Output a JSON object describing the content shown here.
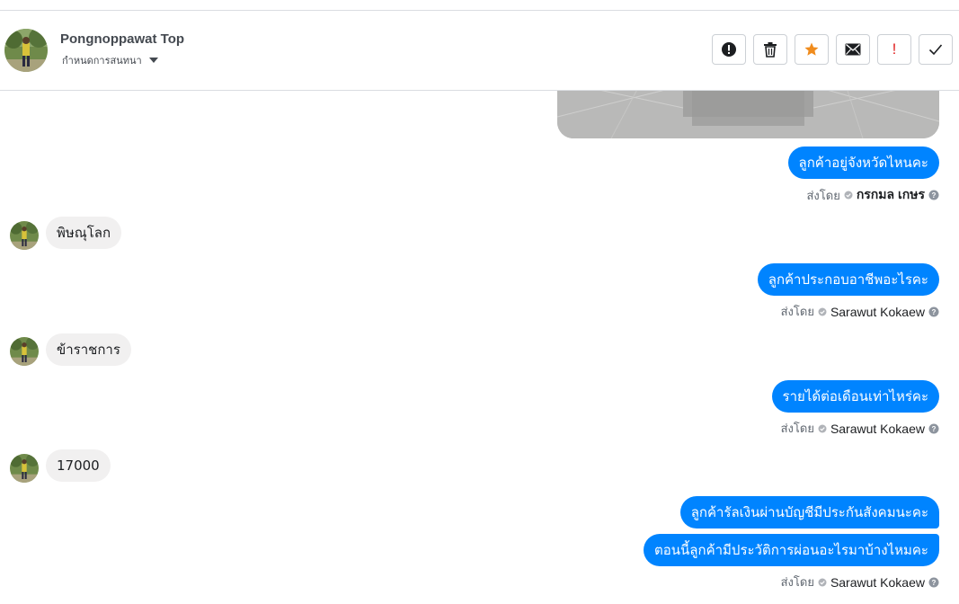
{
  "header": {
    "contact_name": "Pongnoppawat Top",
    "subtitle": "กำหนดการสนทนา",
    "actions": [
      {
        "name": "report-icon",
        "label": "!"
      },
      {
        "name": "trash-icon",
        "label": ""
      },
      {
        "name": "star-icon",
        "label": "",
        "color": "#f08c1d"
      },
      {
        "name": "envelope-icon",
        "label": ""
      },
      {
        "name": "exclamation-icon",
        "label": "!",
        "color": "#e02020"
      },
      {
        "name": "check-icon",
        "label": ""
      }
    ]
  },
  "messages": [
    {
      "id": "m1",
      "side": "out",
      "text": "ลูกค้าอยู่จังหวัดไหนคะ",
      "sent_by_label": "ส่งโดย",
      "sender": "กรกมล เกษร"
    },
    {
      "id": "m2",
      "side": "in",
      "text": "พิษณุโลก"
    },
    {
      "id": "m3",
      "side": "out",
      "text": "ลูกค้าประกอบอาชีพอะไรคะ",
      "sent_by_label": "ส่งโดย",
      "sender": "Sarawut Kokaew"
    },
    {
      "id": "m4",
      "side": "in",
      "text": "ข้าราชการ"
    },
    {
      "id": "m5",
      "side": "out",
      "text": "รายได้ต่อเดือนเท่าไหร่คะ",
      "sent_by_label": "ส่งโดย",
      "sender": "Sarawut Kokaew"
    },
    {
      "id": "m6",
      "side": "in",
      "text": "17000"
    },
    {
      "id": "m7",
      "side": "out",
      "text": "ลูกค้ารัลเงินผ่านบัญชีมีประกันสังคมนะคะ"
    },
    {
      "id": "m8",
      "side": "out",
      "text": "ตอนนี้ลูกค้ามีประวัติการผ่อนอะไรมาบ้างไหมคะ",
      "sent_by_label": "ส่งโดย",
      "sender": "Sarawut Kokaew"
    }
  ],
  "colors": {
    "accent": "#0084ff",
    "incoming_bubble": "#f1f0f0",
    "star": "#f08c1d",
    "alert": "#e02020"
  }
}
